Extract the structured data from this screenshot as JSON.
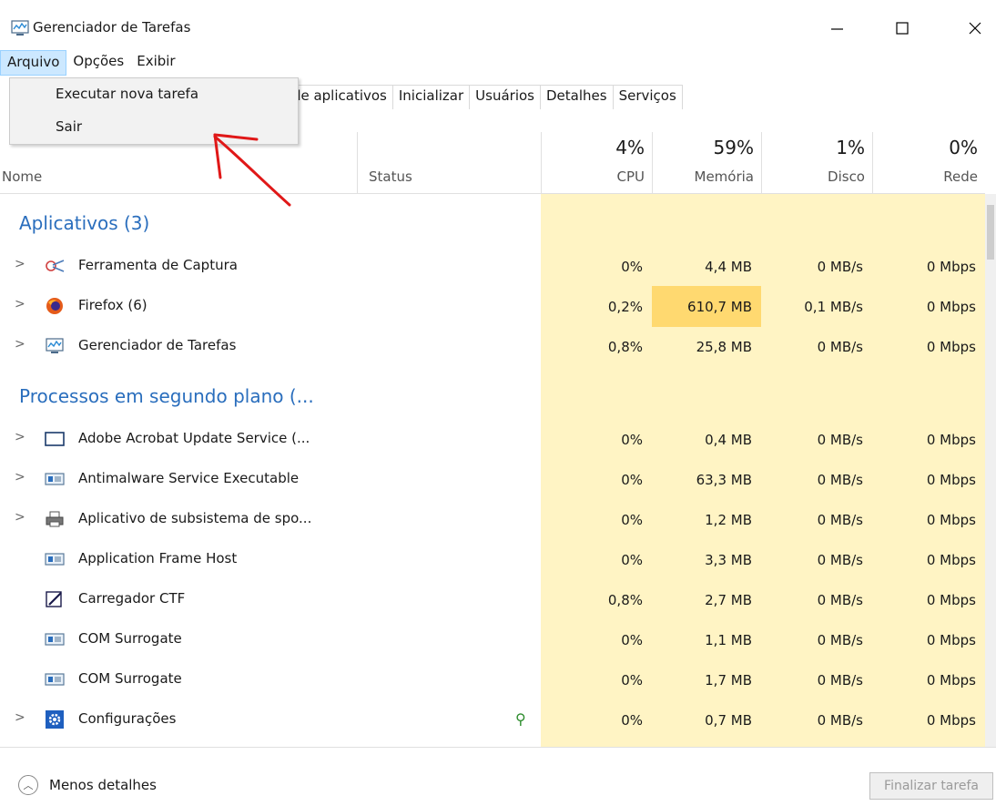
{
  "window": {
    "title": "Gerenciador de Tarefas",
    "minimize": "—",
    "maximize": "☐",
    "close": "✕"
  },
  "menu": [
    "Arquivo",
    "Opções",
    "Exibir"
  ],
  "dropdown": {
    "items": [
      "Executar nova tarefa",
      "Sair"
    ]
  },
  "tabs": [
    "o de aplicativos",
    "Inicializar",
    "Usuários",
    "Detalhes",
    "Serviços"
  ],
  "header": {
    "name": "Nome",
    "status": "Status",
    "cpu_pct": "4%",
    "cpu": "CPU",
    "mem_pct": "59%",
    "mem": "Memória",
    "disk_pct": "1%",
    "disk": "Disco",
    "net_pct": "0%",
    "net": "Rede"
  },
  "groups": {
    "apps": "Aplicativos (3)",
    "background": "Processos em segundo plano (..."
  },
  "apps": [
    {
      "name": "Ferramenta de Captura",
      "cpu": "0%",
      "mem": "4,4 MB",
      "disk": "0 MB/s",
      "net": "0 Mbps",
      "icon": "snipping-tool-icon"
    },
    {
      "name": "Firefox (6)",
      "cpu": "0,2%",
      "mem": "610,7 MB",
      "disk": "0,1 MB/s",
      "net": "0 Mbps",
      "icon": "firefox-icon"
    },
    {
      "name": "Gerenciador de Tarefas",
      "cpu": "0,8%",
      "mem": "25,8 MB",
      "disk": "0 MB/s",
      "net": "0 Mbps",
      "icon": "task-manager-icon"
    }
  ],
  "background": [
    {
      "name": "Adobe Acrobat Update Service (...",
      "cpu": "0%",
      "mem": "0,4 MB",
      "disk": "0 MB/s",
      "net": "0 Mbps",
      "icon": "window-icon"
    },
    {
      "name": "Antimalware Service Executable",
      "cpu": "0%",
      "mem": "63,3 MB",
      "disk": "0 MB/s",
      "net": "0 Mbps",
      "icon": "service-icon"
    },
    {
      "name": "Aplicativo de subsistema de spo...",
      "cpu": "0%",
      "mem": "1,2 MB",
      "disk": "0 MB/s",
      "net": "0 Mbps",
      "icon": "printer-icon"
    },
    {
      "name": "Application Frame Host",
      "cpu": "0%",
      "mem": "3,3 MB",
      "disk": "0 MB/s",
      "net": "0 Mbps",
      "icon": "service-icon"
    },
    {
      "name": "Carregador CTF",
      "cpu": "0,8%",
      "mem": "2,7 MB",
      "disk": "0 MB/s",
      "net": "0 Mbps",
      "icon": "pen-icon"
    },
    {
      "name": "COM Surrogate",
      "cpu": "0%",
      "mem": "1,1 MB",
      "disk": "0 MB/s",
      "net": "0 Mbps",
      "icon": "service-icon"
    },
    {
      "name": "COM Surrogate",
      "cpu": "0%",
      "mem": "1,7 MB",
      "disk": "0 MB/s",
      "net": "0 Mbps",
      "icon": "service-icon"
    },
    {
      "name": "Configurações",
      "cpu": "0%",
      "mem": "0,7 MB",
      "disk": "0 MB/s",
      "net": "0 Mbps",
      "icon": "gear-icon"
    }
  ],
  "footer": {
    "less_details": "Menos detalhes",
    "end_task": "Finalizar tarefa"
  },
  "colors": {
    "accent": "#2a6ebd",
    "heat_light": "#fff4c4",
    "heat_mid": "#ffd970",
    "annotation": "#e01818"
  }
}
